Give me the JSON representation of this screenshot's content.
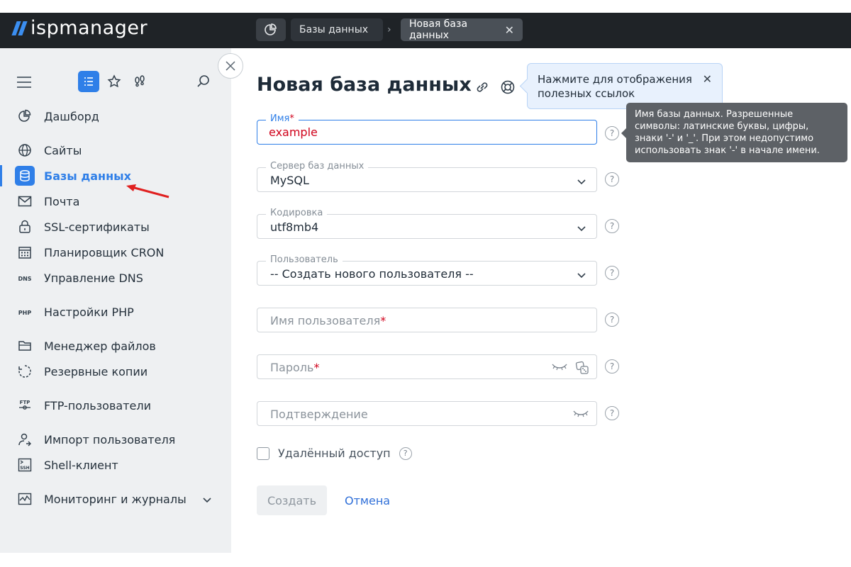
{
  "header": {
    "logo_text": "ispmanager",
    "breadcrumbs": [
      "Базы данных",
      "Новая база данных"
    ]
  },
  "sidebar": {
    "items": [
      {
        "label": "Дашборд",
        "icon": "pie-chart-icon"
      },
      {
        "label": "Сайты",
        "icon": "globe-icon"
      },
      {
        "label": "Базы данных",
        "icon": "database-icon",
        "active": true
      },
      {
        "label": "Почта",
        "icon": "mail-icon"
      },
      {
        "label": "SSL-сертификаты",
        "icon": "lock-icon"
      },
      {
        "label": "Планировщик CRON",
        "icon": "calendar-icon"
      },
      {
        "label": "Управление DNS",
        "icon": "dns-icon"
      },
      {
        "label": "Настройки PHP",
        "icon": "php-icon"
      },
      {
        "label": "Менеджер файлов",
        "icon": "folder-icon"
      },
      {
        "label": "Резервные копии",
        "icon": "backup-icon"
      },
      {
        "label": "FTP-пользователи",
        "icon": "ftp-icon"
      },
      {
        "label": "Импорт пользователя",
        "icon": "user-import-icon"
      },
      {
        "label": "Shell-клиент",
        "icon": "ssh-icon"
      },
      {
        "label": "Мониторинг и журналы",
        "icon": "monitoring-icon"
      }
    ]
  },
  "main": {
    "title": "Новая база данных",
    "help_tip": "Нажмите для отображения полезных ссылок",
    "field_tip": "Имя базы данных. Разрешенные символы: латинские буквы, цифры, знаки '-' и '_'. При этом недопустимо использовать знак '-' в начале имени.",
    "fields": {
      "name_label": "Имя",
      "name_value": "example",
      "server_label": "Сервер баз данных",
      "server_value": "MySQL",
      "encoding_label": "Кодировка",
      "encoding_value": "utf8mb4",
      "user_label": "Пользователь",
      "user_value": "-- Создать нового пользователя --",
      "username_placeholder": "Имя пользователя",
      "password_placeholder": "Пароль",
      "confirm_placeholder": "Подтверждение"
    },
    "remote_access_label": "Удалённый доступ",
    "create_label": "Создать",
    "cancel_label": "Отмена",
    "required_mark": "*",
    "help_mark": "?"
  },
  "colors": {
    "accent": "#2f7fe8",
    "error": "#d0021b",
    "topbar": "#1f2327"
  }
}
